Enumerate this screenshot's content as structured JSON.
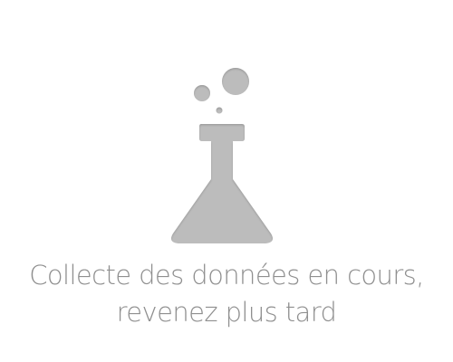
{
  "empty_state": {
    "illustration": {
      "icon": "flask-icon",
      "color": "#bcbcbc",
      "shadow": "#9f9f9f"
    },
    "message": {
      "line1": "Collecte des données en cours,",
      "line2": "revenez plus tard"
    },
    "text_color": "#8f8f8f",
    "background": "#ffffff"
  }
}
